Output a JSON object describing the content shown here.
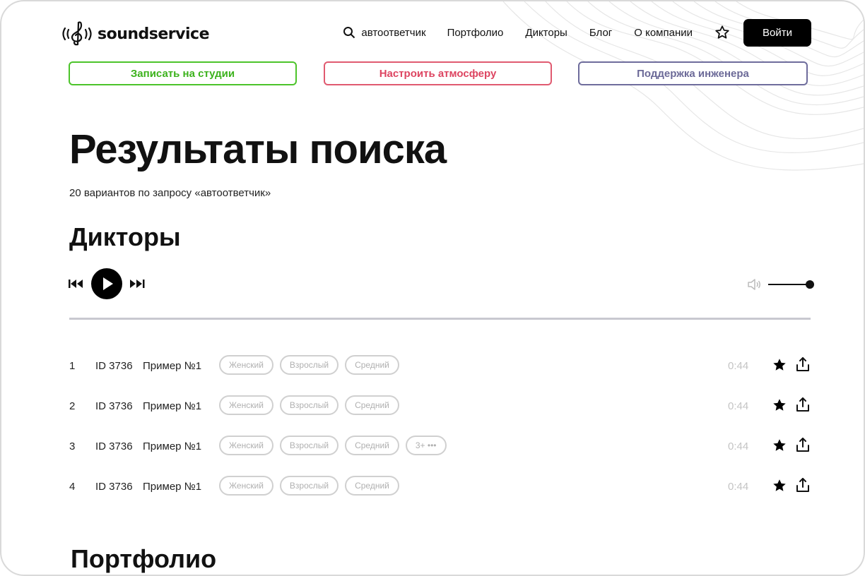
{
  "brand": {
    "logo_text": "soundservice"
  },
  "nav": {
    "search_text": "автоответчик",
    "items": [
      "Портфолио",
      "Дикторы",
      "Блог",
      "О компании"
    ],
    "login_label": "Войти"
  },
  "cta": {
    "record_label": "Записать на студии",
    "atmosphere_label": "Настроить атмосферу",
    "support_label": "Поддержка инженера"
  },
  "colors": {
    "record": "#3cb21c",
    "atmosphere": "#dd4561",
    "support": "#6c6a98",
    "accent": "#000000"
  },
  "page": {
    "title": "Результаты поиска",
    "subtitle": "20 вариантов по запросу «автоответчик»"
  },
  "sections": {
    "speakers_title": "Дикторы",
    "portfolio_title": "Портфолио"
  },
  "player": {
    "icons": [
      "rewind-icon",
      "play-icon",
      "fast-forward-icon",
      "volume-icon"
    ],
    "volume_level": 1.0
  },
  "tracks": [
    {
      "num": "1",
      "id": "ID 3736",
      "name": "Пример №1",
      "tags": [
        "Женский",
        "Взрослый",
        "Средний"
      ],
      "duration": "0:44"
    },
    {
      "num": "2",
      "id": "ID 3736",
      "name": "Пример №1",
      "tags": [
        "Женский",
        "Взрослый",
        "Средний"
      ],
      "duration": "0:44"
    },
    {
      "num": "3",
      "id": "ID 3736",
      "name": "Пример №1",
      "tags": [
        "Женский",
        "Взрослый",
        "Средний"
      ],
      "more": "3+ •••",
      "duration": "0:44"
    },
    {
      "num": "4",
      "id": "ID 3736",
      "name": "Пример №1",
      "tags": [
        "Женский",
        "Взрослый",
        "Средний"
      ],
      "duration": "0:44"
    }
  ]
}
